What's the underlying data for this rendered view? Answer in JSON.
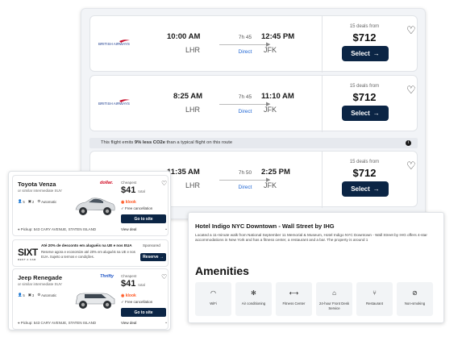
{
  "flights": [
    {
      "dep_time": "10:00 AM",
      "dep_code": "LHR",
      "duration": "7h 45",
      "stops": "Direct",
      "arr_time": "12:45 PM",
      "arr_code": "JFK",
      "deals": "15 deals from",
      "price": "$712",
      "select": "Select"
    },
    {
      "dep_time": "8:25 AM",
      "dep_code": "LHR",
      "duration": "7h 45",
      "stops": "Direct",
      "arr_time": "11:10 AM",
      "arr_code": "JFK",
      "deals": "15 deals from",
      "price": "$712",
      "select": "Select"
    },
    {
      "dep_time": "11:35 AM",
      "dep_code": "LHR",
      "duration": "7h 50",
      "stops": "Direct",
      "arr_time": "2:25 PM",
      "arr_code": "JFK",
      "deals": "15 deals from",
      "price": "$712",
      "select": "Select"
    }
  ],
  "co2_banner": {
    "prefix": "This flight emits ",
    "bold": "9% less CO2e",
    "suffix": " than a typical flight on this route"
  },
  "cars": [
    {
      "title": "Toyota Venza",
      "sub": "or similar intermediate SUV",
      "vendor": "dollar.",
      "seats": "5",
      "bags": "2",
      "trans": "Automatic",
      "pickup": "Pickup: 543 CARY AVENUE, STATEN ISLAND",
      "price_label": "Cheapest",
      "price": "$41",
      "price_unit": "total",
      "provider": "klook",
      "free": "Free cancellation",
      "go": "Go to site",
      "view": "View deal"
    },
    {
      "title": "Jeep Renegade",
      "sub": "or similar intermediate SUV",
      "vendor": "Thrifty",
      "seats": "5",
      "bags": "3",
      "trans": "Automatic",
      "pickup": "Pickup: 543 CARY AVENUE, STATEN ISLAND",
      "price_label": "Cheapest",
      "price": "$41",
      "price_unit": "total",
      "provider": "klook",
      "free": "Free cancellation",
      "go": "Go to site",
      "view": "View deal"
    }
  ],
  "sixt": {
    "logo": "SIXT",
    "logo_sub": "RENT A CAR",
    "head": "Até 20% de desconto em aluguéis na UE e nos EUA",
    "desc": "Reserve agora e economize até 20% em aluguéis na UE e nos EUA. Sujeito a termos e condições.",
    "sponsored": "Sponsored",
    "reserve": "Reserve"
  },
  "hotel": {
    "name": "Hotel Indigo NYC Downtown - Wall Street by IHG",
    "desc": "Located a 11-minute walk from National September 11 Memorial & Museum, Hotel Indigo NYC Downtown - Wall Street by IHG offers 4-star accommodations in New York and has a fitness center, a restaurant and a bar. The property is around 1",
    "amenities_title": "Amenities",
    "amenities": [
      {
        "label": "WiFi",
        "icon": "wifi-icon"
      },
      {
        "label": "Air conditioning",
        "icon": "snowflake-icon"
      },
      {
        "label": "Fitness Center",
        "icon": "dumbbell-icon"
      },
      {
        "label": "24-hour Front Desk Service",
        "icon": "bell-icon"
      },
      {
        "label": "Restaurant",
        "icon": "utensils-icon"
      },
      {
        "label": "Non-smoking",
        "icon": "no-smoking-icon"
      }
    ]
  }
}
